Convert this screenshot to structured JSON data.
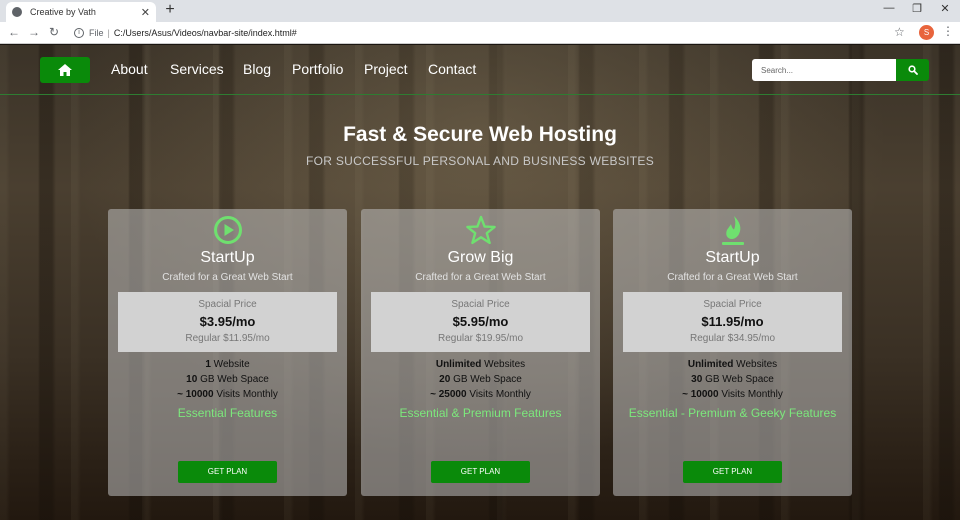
{
  "browser": {
    "tab_title": "Creative by Vath",
    "tab_close": "✕",
    "new_tab": "+",
    "window_controls": [
      "—",
      "❐",
      "✕"
    ],
    "nav_back": "←",
    "nav_forward": "→",
    "nav_reload": "↻",
    "info_icon": "i",
    "file_label": "File",
    "separator": "|",
    "url": "C:/Users/Asus/Videos/navbar-site/index.html#",
    "bookmark": "☆",
    "profile_initial": "S",
    "menu": "⋮"
  },
  "navbar": {
    "links": [
      "About",
      "Services",
      "Blog",
      "Portfolio",
      "Project",
      "Contact"
    ],
    "search_placeholder": "Search..."
  },
  "hero": {
    "title": "Fast & Secure Web Hosting",
    "subtitle": "FOR SUCCESSFUL PERSONAL AND BUSINESS WEBSITES"
  },
  "plans": [
    {
      "icon": "play-circle-icon",
      "name": "StartUp",
      "tagline": "Crafted for a Great Web Start",
      "price_label": "Spacial Price",
      "price": "$3.95/mo",
      "regular": "Regular $11.95/mo",
      "features": [
        {
          "strong": "1",
          "text": " Website"
        },
        {
          "strong": "10",
          "text": " GB Web Space"
        },
        {
          "strong": "~ 10000",
          "text": " Visits Monthly"
        }
      ],
      "features_link": "Essential Features",
      "button": "GET PLAN"
    },
    {
      "icon": "star-icon",
      "name": "Grow Big",
      "tagline": "Crafted for a Great Web Start",
      "price_label": "Spacial Price",
      "price": "$5.95/mo",
      "regular": "Regular $19.95/mo",
      "features": [
        {
          "strong": "Unlimited",
          "text": " Websites"
        },
        {
          "strong": "20",
          "text": " GB Web Space"
        },
        {
          "strong": "~ 25000",
          "text": " Visits Monthly"
        }
      ],
      "features_link": "Essential & Premium Features",
      "button": "GET PLAN"
    },
    {
      "icon": "flame-icon",
      "name": "StartUp",
      "tagline": "Crafted for a Great Web Start",
      "price_label": "Spacial Price",
      "price": "$11.95/mo",
      "regular": "Regular $34.95/mo",
      "features": [
        {
          "strong": "Unlimited",
          "text": " Websites"
        },
        {
          "strong": "30",
          "text": " GB Web Space"
        },
        {
          "strong": "~ 10000",
          "text": " Visits Monthly"
        }
      ],
      "features_link": "Essential - Premium & Geeky Features",
      "button": "GET PLAN"
    }
  ],
  "colors": {
    "accent": "#0a8a0a",
    "feature_link": "#7ce87c",
    "icon_green": "#6fe06f"
  }
}
